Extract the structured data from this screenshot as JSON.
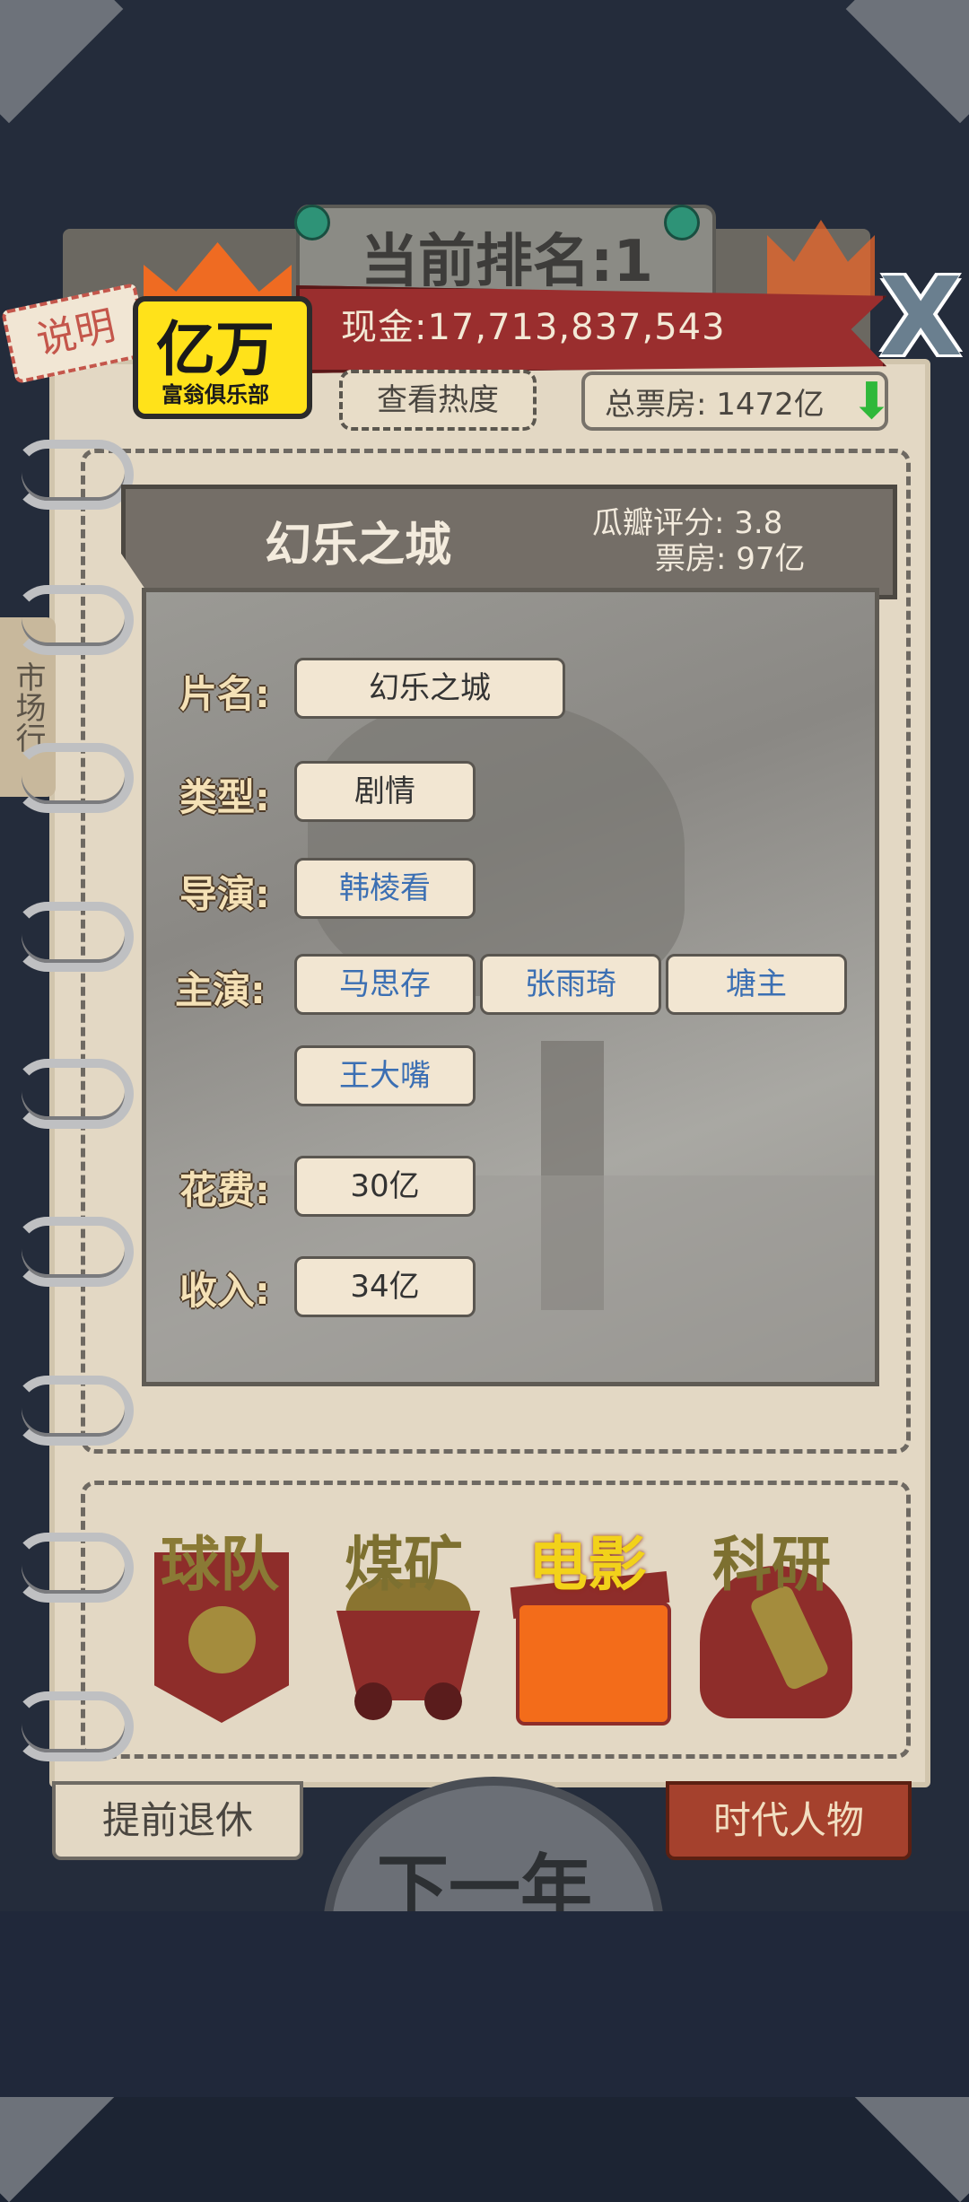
{
  "header": {
    "rank_title": "当前排名:1",
    "cash": "现金:17,713,837,543",
    "explain_label": "说明",
    "logo_main": "亿万",
    "logo_sub": "富翁俱乐部",
    "view_heat_label": "查看热度",
    "total_box_office": "总票房: 1472亿",
    "close_label": "X"
  },
  "side_tab": {
    "label": "市场行"
  },
  "movie": {
    "title": "幻乐之城",
    "melon_score": "瓜瓣评分: 3.8",
    "box_office": "票房: 97亿",
    "fields": {
      "name_label": "片名:",
      "name_value": "幻乐之城",
      "genre_label": "类型:",
      "genre_value": "剧情",
      "director_label": "导演:",
      "director_value": "韩棱看",
      "cast_label": "主演:",
      "cast": [
        "马思存",
        "张雨琦",
        "塘主",
        "王大嘴"
      ],
      "cost_label": "花费:",
      "cost_value": "30亿",
      "income_label": "收入:",
      "income_value": "34亿"
    }
  },
  "categories": [
    {
      "label": "球队",
      "icon": "pennant-ball-icon"
    },
    {
      "label": "煤矿",
      "icon": "mine-cart-icon"
    },
    {
      "label": "电影",
      "icon": "clapperboard-icon"
    },
    {
      "label": "科研",
      "icon": "microscope-icon"
    }
  ],
  "bottom": {
    "retire_label": "提前退休",
    "next_year_label": "下一年",
    "era_people_label": "时代人物"
  }
}
